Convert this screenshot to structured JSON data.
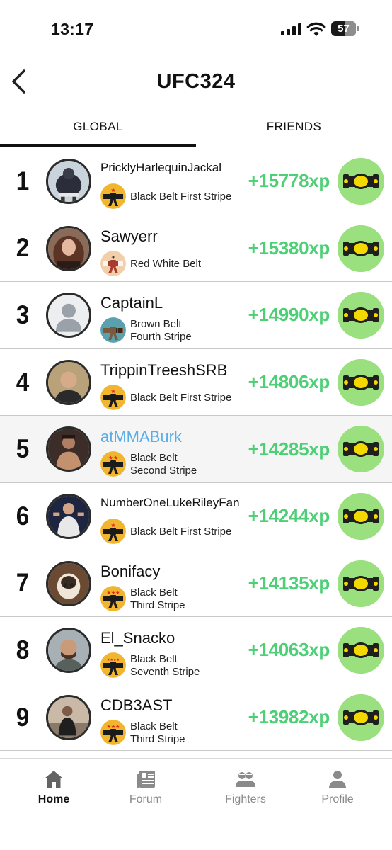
{
  "status": {
    "time": "13:17",
    "battery": "57"
  },
  "header": {
    "title": "UFC324"
  },
  "tabs": [
    {
      "label": "GLOBAL",
      "active": true
    },
    {
      "label": "FRIENDS",
      "active": false
    }
  ],
  "rows": [
    {
      "rank": "1",
      "name": "PricklyHarlequinJackal",
      "belt_line1": "Black Belt  First Stripe",
      "belt_line2": "",
      "xp": "+15778xp"
    },
    {
      "rank": "2",
      "name": "Sawyerr",
      "belt_line1": "Red  White Belt",
      "belt_line2": "",
      "xp": "+15380xp"
    },
    {
      "rank": "3",
      "name": "CaptainL",
      "belt_line1": "Brown Belt",
      "belt_line2": "Fourth Stripe",
      "xp": "+14990xp"
    },
    {
      "rank": "4",
      "name": "TrippinTreeshSRB",
      "belt_line1": "Black Belt  First Stripe",
      "belt_line2": "",
      "xp": "+14806xp"
    },
    {
      "rank": "5",
      "name": "atMMABurk",
      "belt_line1": "Black Belt",
      "belt_line2": "Second Stripe",
      "xp": "+14285xp"
    },
    {
      "rank": "6",
      "name": "NumberOneLukeRileyFan",
      "belt_line1": "Black Belt  First Stripe",
      "belt_line2": "",
      "xp": "+14244xp"
    },
    {
      "rank": "7",
      "name": "Bonifacy",
      "belt_line1": "Black Belt",
      "belt_line2": "Third Stripe",
      "xp": "+14135xp"
    },
    {
      "rank": "8",
      "name": "El_Snacko",
      "belt_line1": "Black Belt",
      "belt_line2": "Seventh Stripe",
      "xp": "+14063xp"
    },
    {
      "rank": "9",
      "name": "CDB3AST",
      "belt_line1": "Black Belt",
      "belt_line2": "Third Stripe",
      "xp": "+13982xp"
    }
  ],
  "nav": [
    {
      "label": "Home",
      "icon": "home-icon"
    },
    {
      "label": "Forum",
      "icon": "newspaper-icon"
    },
    {
      "label": "Fighters",
      "icon": "fighters-icon"
    },
    {
      "label": "Profile",
      "icon": "person-icon"
    }
  ],
  "colors": {
    "xp_green": "#4ccf75",
    "belt_circle": "#9be07f",
    "link_blue": "#5aaee8"
  }
}
